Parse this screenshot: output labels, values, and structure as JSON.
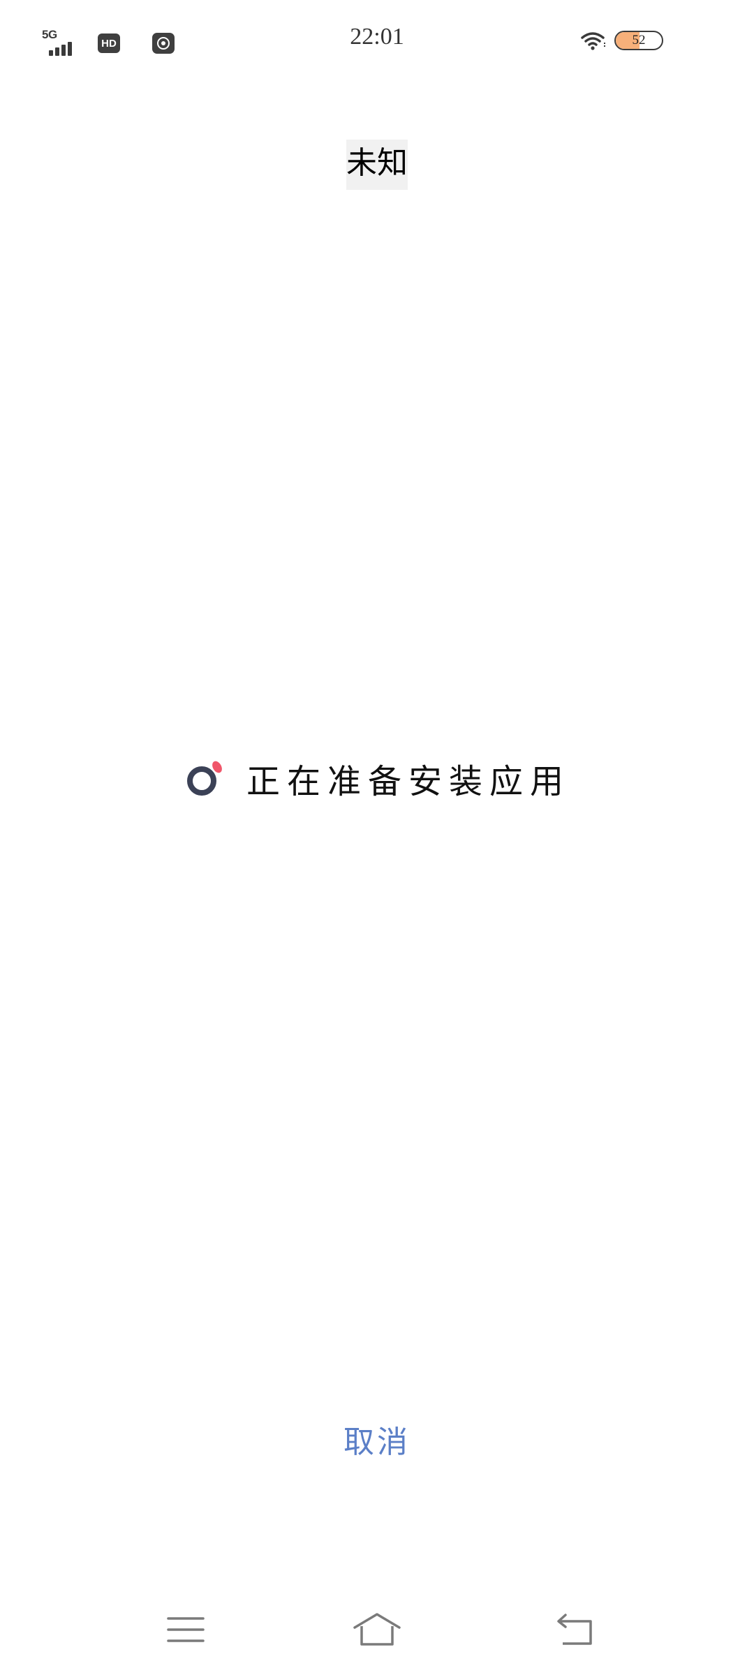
{
  "status_bar": {
    "network_type": "5G",
    "hd_badge": "HD",
    "time": "22:01",
    "battery_level": "52",
    "battery_fraction": 0.52,
    "icons": [
      "signal-icon",
      "hd-icon",
      "app-notification-icon",
      "wifi-icon",
      "battery-icon"
    ]
  },
  "installer": {
    "app_name": "未知",
    "status": "正在准备安装应用",
    "cancel_label": "取消",
    "spinner_colors": {
      "ring": "#3b4156",
      "accent": "#f0566a"
    },
    "link_color": "#5b7fc7"
  },
  "nav_bar": {
    "buttons": [
      "menu-icon",
      "home-icon",
      "back-icon"
    ]
  }
}
